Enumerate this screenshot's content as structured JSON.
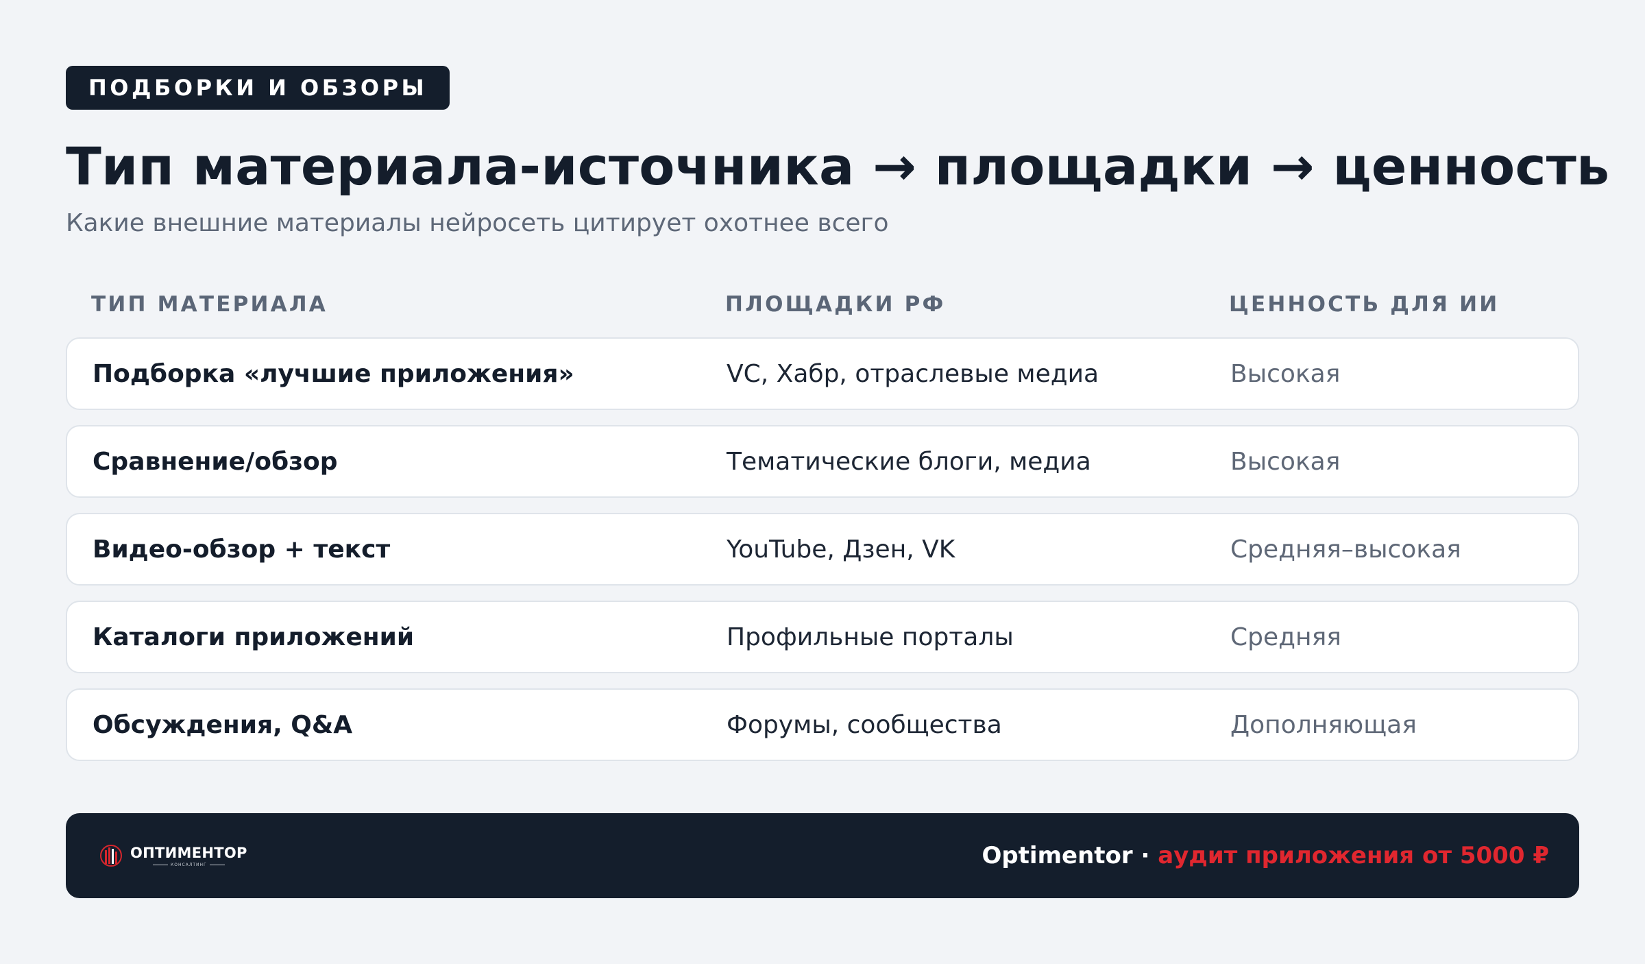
{
  "header": {
    "eyebrow": "ПОДБОРКИ И ОБЗОРЫ",
    "title": "Тип материала-источника → площадки → ценность",
    "subtitle": "Какие внешние материалы нейросеть цитирует охотнее всего"
  },
  "table": {
    "columns": [
      "ТИП МАТЕРИАЛА",
      "ПЛОЩАДКИ РФ",
      "ЦЕННОСТЬ ДЛЯ ИИ"
    ],
    "rows": [
      {
        "type": "Подборка «лучшие приложения»",
        "platforms": "VC, Хабр, отраслевые медиа",
        "value": "Высокая"
      },
      {
        "type": "Сравнение/обзор",
        "platforms": "Тематические блоги, медиа",
        "value": "Высокая"
      },
      {
        "type": "Видео-обзор + текст",
        "platforms": "YouTube, Дзен, VK",
        "value": "Средняя–высокая"
      },
      {
        "type": "Каталоги приложений",
        "platforms": "Профильные порталы",
        "value": "Средняя"
      },
      {
        "type": "Обсуждения, Q&A",
        "platforms": "Форумы, сообщества",
        "value": "Дополняющая"
      }
    ]
  },
  "footer": {
    "logo_name": "ОПТИМЕНТОР",
    "logo_sub": "КОНСАЛТИНГ",
    "logo_icon": "optimentor-logo-icon",
    "promo_main": "Optimentor · ",
    "promo_accent": "аудит приложения от 5000 ₽"
  },
  "colors": {
    "background": "#f2f4f7",
    "dark": "#141e2c",
    "accent": "#e0272f",
    "muted": "#5e6878"
  }
}
